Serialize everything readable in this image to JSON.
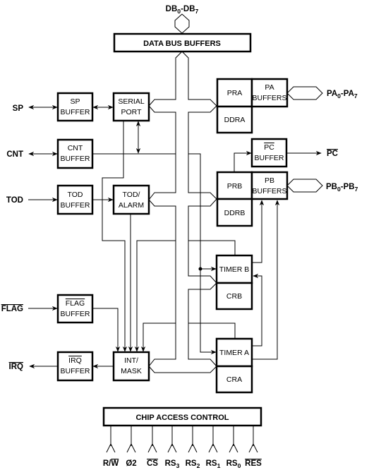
{
  "diagram": {
    "data_bus": {
      "label": [
        "DB",
        {
          "t": "0",
          "sub": true
        },
        "-DB",
        {
          "t": "7",
          "sub": true
        }
      ],
      "buffers_label": "DATA BUS BUFFERS"
    },
    "blocks": {
      "sp_buffer": [
        "SP",
        "BUFFER"
      ],
      "serial_port": [
        "SERIAL",
        "PORT"
      ],
      "cnt_buffer": [
        "CNT",
        "BUFFER"
      ],
      "tod_buffer": [
        "TOD",
        "BUFFER"
      ],
      "tod_alarm": [
        "TOD/",
        "ALARM"
      ],
      "flag_buffer": [
        [
          {
            "t": "FLAG",
            "over": true
          }
        ],
        "BUFFER"
      ],
      "irq_buffer": [
        [
          {
            "t": "IRQ",
            "over": true
          }
        ],
        "BUFFER"
      ],
      "int_mask": [
        "INT/",
        "MASK"
      ],
      "pra": "PRA",
      "ddra": "DDRA",
      "pa_buffers": [
        "PA",
        "BUFFERS"
      ],
      "pc_buffer": [
        [
          {
            "t": "PC",
            "over": true
          }
        ],
        "BUFFER"
      ],
      "prb": "PRB",
      "ddrb": "DDRB",
      "pb_buffers": [
        "PB",
        "BUFFERS"
      ],
      "timer_b": "TIMER B",
      "crb": "CRB",
      "timer_a": "TIMER A",
      "cra": "CRA"
    },
    "external_pins": {
      "sp": "SP",
      "cnt": "CNT",
      "tod": "TOD",
      "flag": [
        {
          "t": "FLAG",
          "over": true
        }
      ],
      "irq": [
        {
          "t": "IRQ",
          "over": true
        }
      ],
      "pa": [
        "PA",
        {
          "t": "0",
          "sub": true
        },
        "-PA",
        {
          "t": "7",
          "sub": true
        }
      ],
      "pc": [
        {
          "t": "PC",
          "over": true
        }
      ],
      "pb": [
        "PB",
        {
          "t": "0",
          "sub": true
        },
        "-PB",
        {
          "t": "7",
          "sub": true
        }
      ]
    },
    "chip_access_control": {
      "label": "CHIP ACCESS CONTROL",
      "pins": [
        [
          "R/",
          {
            "t": "W",
            "over": true
          }
        ],
        [
          "Ø2"
        ],
        [
          {
            "t": "CS",
            "over": true
          }
        ],
        [
          "RS",
          {
            "t": "3",
            "sub": true
          }
        ],
        [
          "RS",
          {
            "t": "2",
            "sub": true
          }
        ],
        [
          "RS",
          {
            "t": "1",
            "sub": true
          }
        ],
        [
          "RS",
          {
            "t": "0",
            "sub": true
          }
        ],
        [
          {
            "t": "RES",
            "over": true
          }
        ]
      ]
    }
  }
}
